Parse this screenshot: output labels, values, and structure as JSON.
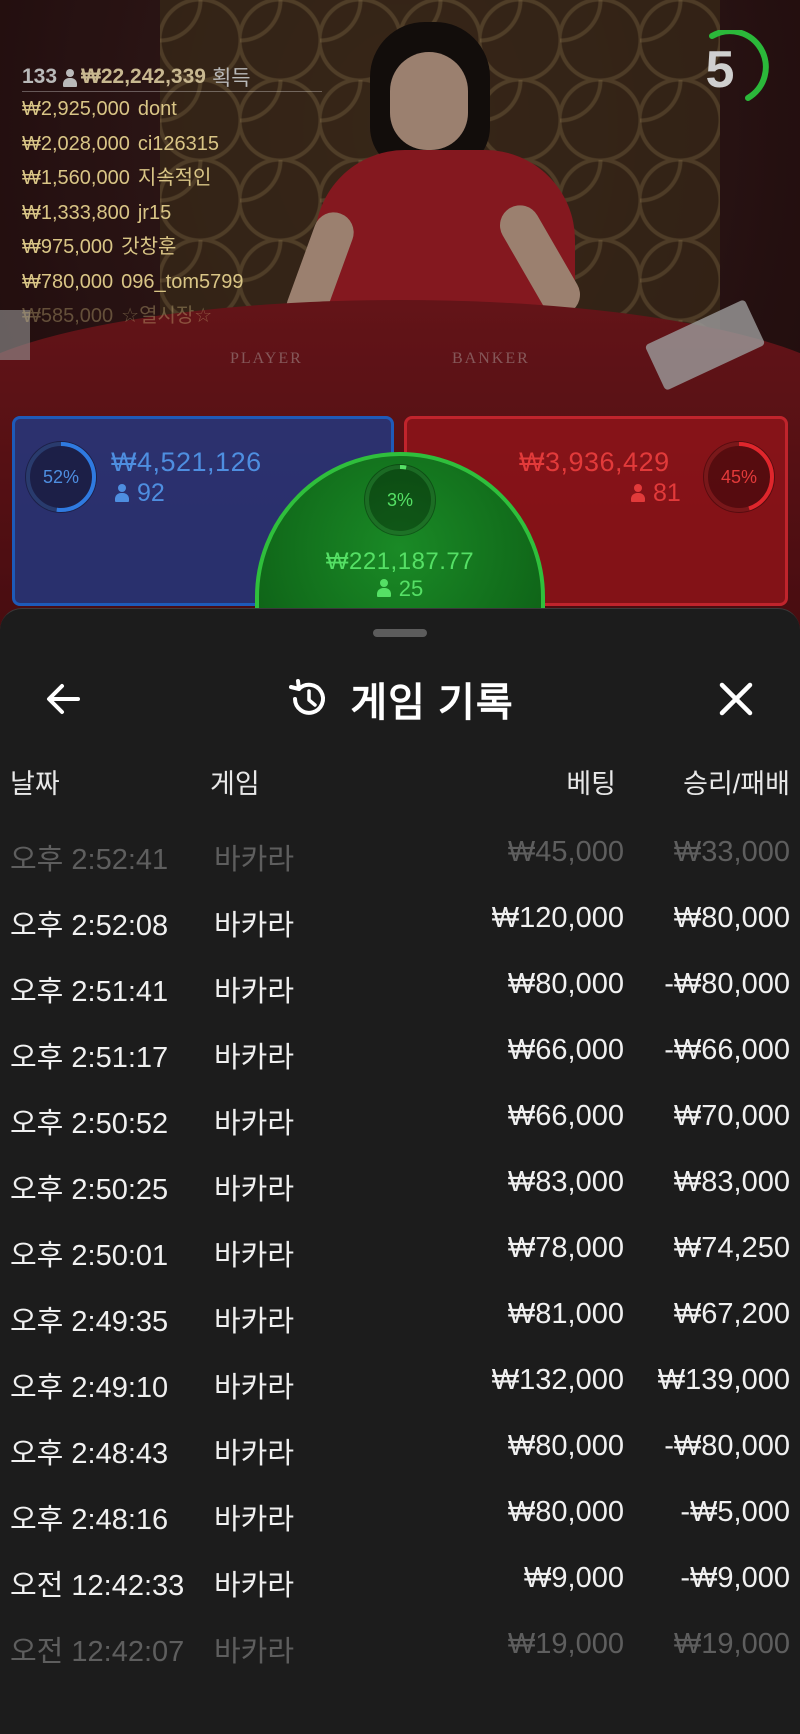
{
  "stream": {
    "winners": {
      "count": "133",
      "total": "₩22,242,339",
      "suffix": "획득",
      "entries": [
        {
          "amount": "₩2,925,000",
          "name": "dont"
        },
        {
          "amount": "₩2,028,000",
          "name": "ci126315"
        },
        {
          "amount": "₩1,560,000",
          "name": "지속적인"
        },
        {
          "amount": "₩1,333,800",
          "name": "jr15"
        },
        {
          "amount": "₩975,000",
          "name": "갓창훈"
        },
        {
          "amount": "₩780,000",
          "name": "096_tom5799"
        },
        {
          "amount": "₩585,000",
          "name": "☆열시장☆"
        }
      ]
    },
    "timer": "5",
    "felt_labels": {
      "player": "PLAYER",
      "banker": "BANKER"
    },
    "bets": {
      "player": {
        "percent": "52%",
        "percent_value": 52,
        "amount": "₩4,521,126",
        "players": "92",
        "color": "#4e8ee0"
      },
      "banker": {
        "percent": "45%",
        "percent_value": 45,
        "amount": "₩3,936,429",
        "players": "81",
        "color": "#e23a3a"
      },
      "tie": {
        "percent": "3%",
        "percent_value": 3,
        "amount": "₩221,187.77",
        "players": "25",
        "color": "#55e065"
      }
    }
  },
  "sheet": {
    "title": "게임 기록",
    "columns": {
      "date": "날짜",
      "game": "게임",
      "bet": "베팅",
      "result": "승리/패배"
    },
    "rows": [
      {
        "date": "오후 2:52:41",
        "game": "바카라",
        "bet": "₩45,000",
        "result": "₩33,000"
      },
      {
        "date": "오후 2:52:08",
        "game": "바카라",
        "bet": "₩120,000",
        "result": "₩80,000"
      },
      {
        "date": "오후 2:51:41",
        "game": "바카라",
        "bet": "₩80,000",
        "result": "-₩80,000"
      },
      {
        "date": "오후 2:51:17",
        "game": "바카라",
        "bet": "₩66,000",
        "result": "-₩66,000"
      },
      {
        "date": "오후 2:50:52",
        "game": "바카라",
        "bet": "₩66,000",
        "result": "₩70,000"
      },
      {
        "date": "오후 2:50:25",
        "game": "바카라",
        "bet": "₩83,000",
        "result": "₩83,000"
      },
      {
        "date": "오후 2:50:01",
        "game": "바카라",
        "bet": "₩78,000",
        "result": "₩74,250"
      },
      {
        "date": "오후 2:49:35",
        "game": "바카라",
        "bet": "₩81,000",
        "result": "₩67,200"
      },
      {
        "date": "오후 2:49:10",
        "game": "바카라",
        "bet": "₩132,000",
        "result": "₩139,000"
      },
      {
        "date": "오후 2:48:43",
        "game": "바카라",
        "bet": "₩80,000",
        "result": "-₩80,000"
      },
      {
        "date": "오후 2:48:16",
        "game": "바카라",
        "bet": "₩80,000",
        "result": "-₩5,000"
      },
      {
        "date": "오전 12:42:33",
        "game": "바카라",
        "bet": "₩9,000",
        "result": "-₩9,000"
      },
      {
        "date": "오전 12:42:07",
        "game": "바카라",
        "bet": "₩19,000",
        "result": "₩19,000"
      }
    ]
  }
}
